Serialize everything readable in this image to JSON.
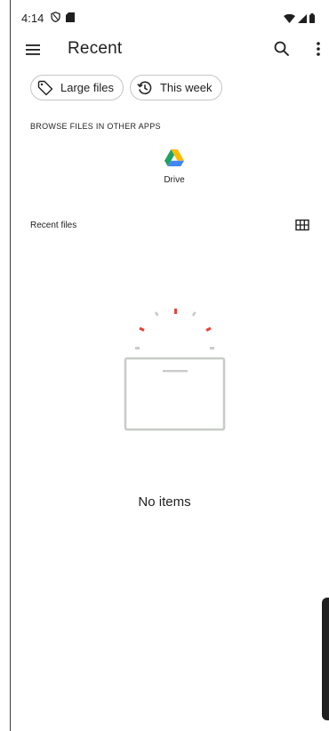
{
  "status_bar": {
    "time": "4:14",
    "left_icons": [
      "shield-icon",
      "sd-card-icon"
    ],
    "right_icons": [
      "wifi-icon",
      "signal-icon",
      "battery-icon"
    ]
  },
  "app_bar": {
    "title": "Recent",
    "actions": [
      "search-icon",
      "more-vert-icon"
    ]
  },
  "filter_chips": [
    {
      "label": "Large files",
      "icon": "tag-icon"
    },
    {
      "label": "This week",
      "icon": "history-icon"
    }
  ],
  "browse_section": {
    "label": "BROWSE FILES IN OTHER APPS",
    "apps": [
      {
        "label": "Drive",
        "icon": "google-drive-icon"
      }
    ]
  },
  "recent_section": {
    "label": "Recent files",
    "view_toggle_icon": "grid-view-icon"
  },
  "empty_state": {
    "text": "No items"
  },
  "colors": {
    "text": "#1f1f1f",
    "chip_border": "#c4c7c5",
    "illustration_gray": "#c8ccc8",
    "illustration_red": "#ea4335",
    "drive_green": "#1ea362",
    "drive_yellow": "#ffba00",
    "drive_blue": "#4285f4"
  }
}
